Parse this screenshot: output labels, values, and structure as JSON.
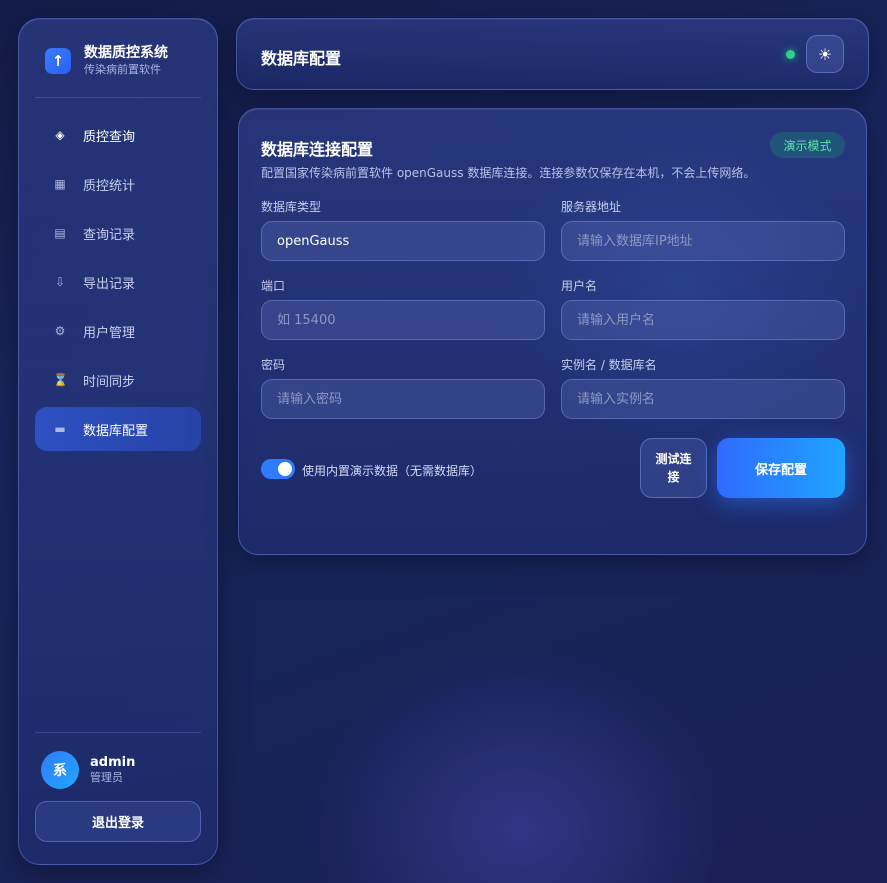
{
  "sidebar": {
    "brand": {
      "title": "数据质控系统",
      "subtitle": "传染病前置软件",
      "logo_icon": "arrow-up-icon"
    },
    "items": [
      {
        "label": "质控查询",
        "icon": "diamond-icon",
        "glyph": "◈"
      },
      {
        "label": "质控统计",
        "icon": "grid-icon",
        "glyph": "▦"
      },
      {
        "label": "查询记录",
        "icon": "list-icon",
        "glyph": "▤"
      },
      {
        "label": "导出记录",
        "icon": "download-icon",
        "glyph": "⇩"
      },
      {
        "label": "用户管理",
        "icon": "gear-icon",
        "glyph": "⚙"
      },
      {
        "label": "时间同步",
        "icon": "hourglass-icon",
        "glyph": "⌛"
      },
      {
        "label": "数据库配置",
        "icon": "database-icon",
        "glyph": "▬"
      }
    ],
    "active_item": "数据库配置",
    "user": {
      "avatar_text": "系",
      "name": "admin",
      "role": "管理员"
    },
    "logout_label": "退出登录"
  },
  "header": {
    "title": "数据库配置",
    "status_color": "#2fd08a",
    "theme_icon": "sun-icon"
  },
  "config": {
    "title": "数据库连接配置",
    "badge": "演示模式",
    "description": "配置国家传染病前置软件 openGauss 数据库连接。连接参数仅保存在本机，不会上传网络。",
    "fields": {
      "db_type": {
        "label": "数据库类型",
        "value": "openGauss",
        "placeholder": ""
      },
      "server": {
        "label": "服务器地址",
        "value": "",
        "placeholder": "请输入数据库IP地址"
      },
      "port": {
        "label": "端口",
        "value": "",
        "placeholder": "如 15400"
      },
      "username": {
        "label": "用户名",
        "value": "",
        "placeholder": "请输入用户名"
      },
      "password": {
        "label": "密码",
        "value": "",
        "placeholder": "请输入密码"
      },
      "instance": {
        "label": "实例名 / 数据库名",
        "value": "",
        "placeholder": "请输入实例名"
      }
    },
    "demo_toggle": {
      "label": "使用内置演示数据（无需数据库）",
      "on": true
    },
    "test_button": "测试连接",
    "save_button": "保存配置"
  },
  "colors": {
    "accent": "#2f7bff",
    "success": "#2fd08a",
    "badge_text": "#5fe0b0"
  }
}
